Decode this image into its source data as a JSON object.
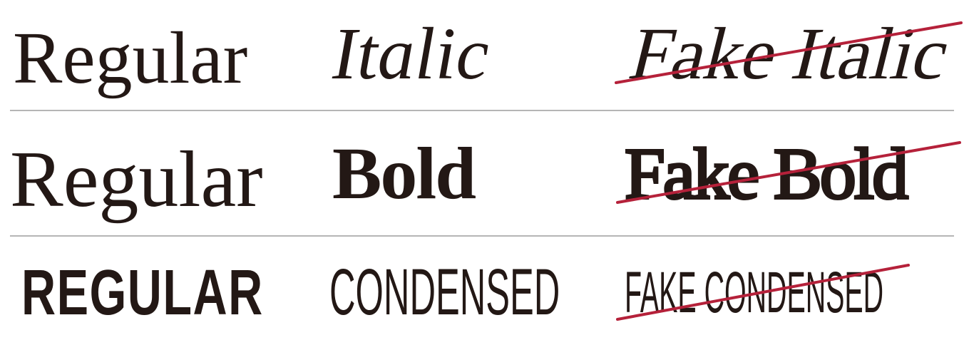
{
  "rows": [
    {
      "regular": "Regular",
      "correct": "Italic",
      "fake": "Fake Italic"
    },
    {
      "regular": "Regular",
      "correct": "Bold",
      "fake": "Fake Bold"
    },
    {
      "regular": "REGULAR",
      "correct": "CONDENSED",
      "fake": "FAKE CONDENSED"
    }
  ],
  "colors": {
    "text": "#231815",
    "strike": "#b5213a",
    "divider": "#b5b5b5",
    "background": "#ffffff"
  }
}
